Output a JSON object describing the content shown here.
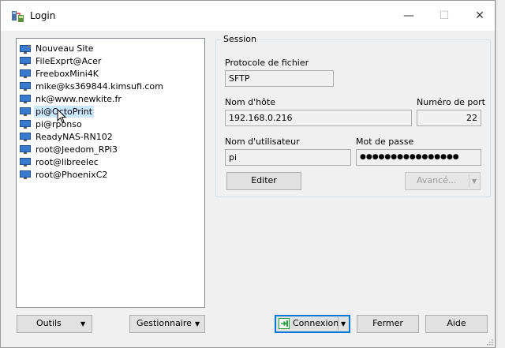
{
  "window": {
    "title": "Login",
    "minimize_glyph": "—",
    "maximize_glyph": "☐",
    "close_glyph": "✕"
  },
  "sites": [
    {
      "label": "Nouveau Site",
      "icon": "new-site-icon"
    },
    {
      "label": "FileExprt@Acer",
      "icon": "computer-icon"
    },
    {
      "label": "FreeboxMini4K",
      "icon": "computer-icon"
    },
    {
      "label": "mike@ks369844.kimsufi.com",
      "icon": "computer-icon"
    },
    {
      "label": "nk@www.newkite.fr",
      "icon": "computer-icon"
    },
    {
      "label": "pi@OctoPrint",
      "icon": "computer-icon",
      "selected": true
    },
    {
      "label": "pi@rponso",
      "icon": "computer-icon"
    },
    {
      "label": "ReadyNAS-RN102",
      "icon": "computer-icon"
    },
    {
      "label": "root@Jeedom_RPi3",
      "icon": "computer-icon"
    },
    {
      "label": "root@libreelec",
      "icon": "computer-icon"
    },
    {
      "label": "root@PhoenixC2",
      "icon": "computer-icon"
    }
  ],
  "session": {
    "group_title": "Session",
    "protocol_label": "Protocole de fichier",
    "protocol_value": "SFTP",
    "host_label": "Nom d'hôte",
    "host_value": "192.168.0.216",
    "port_label": "Numéro de port",
    "port_value": "22",
    "user_label": "Nom d'utilisateur",
    "user_value": "pi",
    "password_label": "Mot de passe",
    "password_value": "●●●●●●●●●●●●●●●●",
    "edit_button": "Editer",
    "advanced_button": "Avancé..."
  },
  "footer": {
    "tools_button": "Outils",
    "manager_button": "Gestionnaire",
    "connect_button": "Connexion",
    "close_button": "Fermer",
    "help_button": "Aide"
  },
  "colors": {
    "selection": "#cce8ff",
    "accent": "#0078d7",
    "connect_icon": "#1e9e3a"
  }
}
